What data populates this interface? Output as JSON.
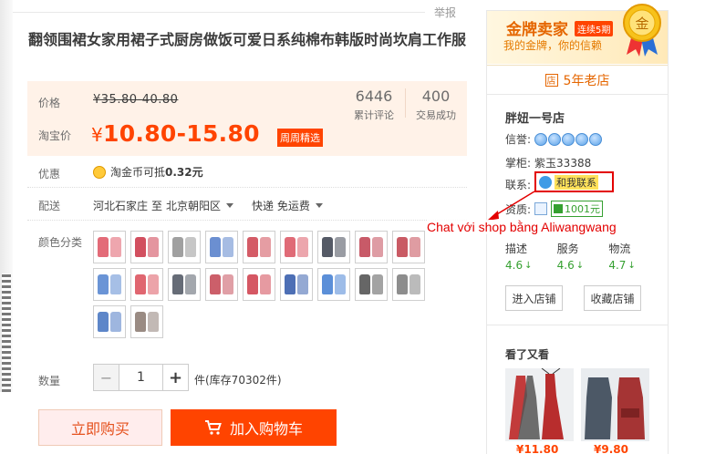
{
  "report": "举报",
  "title": "翻领围裙女家用裙子式厨房做饭可爱日系纯棉布韩版时尚坎肩工作服",
  "price": {
    "label": "价格",
    "original": "¥35.80-40.80",
    "promo_label": "淘宝价",
    "promo_currency": "¥",
    "promo_value": "10.80-15.80",
    "promo_tag": "周周精选"
  },
  "stats": [
    {
      "num": "6446",
      "caption": "累计评论"
    },
    {
      "num": "400",
      "caption": "交易成功"
    }
  ],
  "discount": {
    "label": "优惠",
    "text_prefix": "淘金币可抵",
    "text_value": "0.32元"
  },
  "shipping": {
    "label": "配送",
    "from": "河北石家庄",
    "to_label": "至",
    "to": "北京朝阳区",
    "method": "快递 免运费"
  },
  "colors": {
    "label": "颜色分类"
  },
  "quantity": {
    "label": "数量",
    "value": "1",
    "minus": "−",
    "plus": "+",
    "stock": "件(库存70302件)"
  },
  "buttons": {
    "buy": "立即购买",
    "cart": "加入购物车"
  },
  "store": {
    "gold_title": "金牌卖家",
    "gold_badge": "连续5期",
    "gold_sub": "我的金牌，你的信赖",
    "medal_char": "金",
    "years": "5年老店",
    "years_icon": "店",
    "name": "胖妞一号店",
    "credit_label": "信誉:",
    "keeper_label": "掌柜:",
    "keeper": "紫玉33388",
    "contact_label": "联系:",
    "contact_btn": "和我联系",
    "quality_label": "资质:",
    "deposit": "1001元",
    "ratings": [
      {
        "label": "描述",
        "value": "4.6"
      },
      {
        "label": "服务",
        "value": "4.6"
      },
      {
        "label": "物流",
        "value": "4.7"
      }
    ],
    "enter_btn": "进入店铺",
    "fav_btn": "收藏店铺"
  },
  "annotation": "Chat với shop bằng Aliwangwang",
  "recommend": {
    "title": "看了又看",
    "items": [
      {
        "price": "¥11.80"
      },
      {
        "price": "¥9.80"
      }
    ]
  },
  "colors_meta": {
    "accent": "#ff4400",
    "promo_bg": "#fff2e8",
    "green": "#35a030",
    "annot": "#e30000"
  }
}
